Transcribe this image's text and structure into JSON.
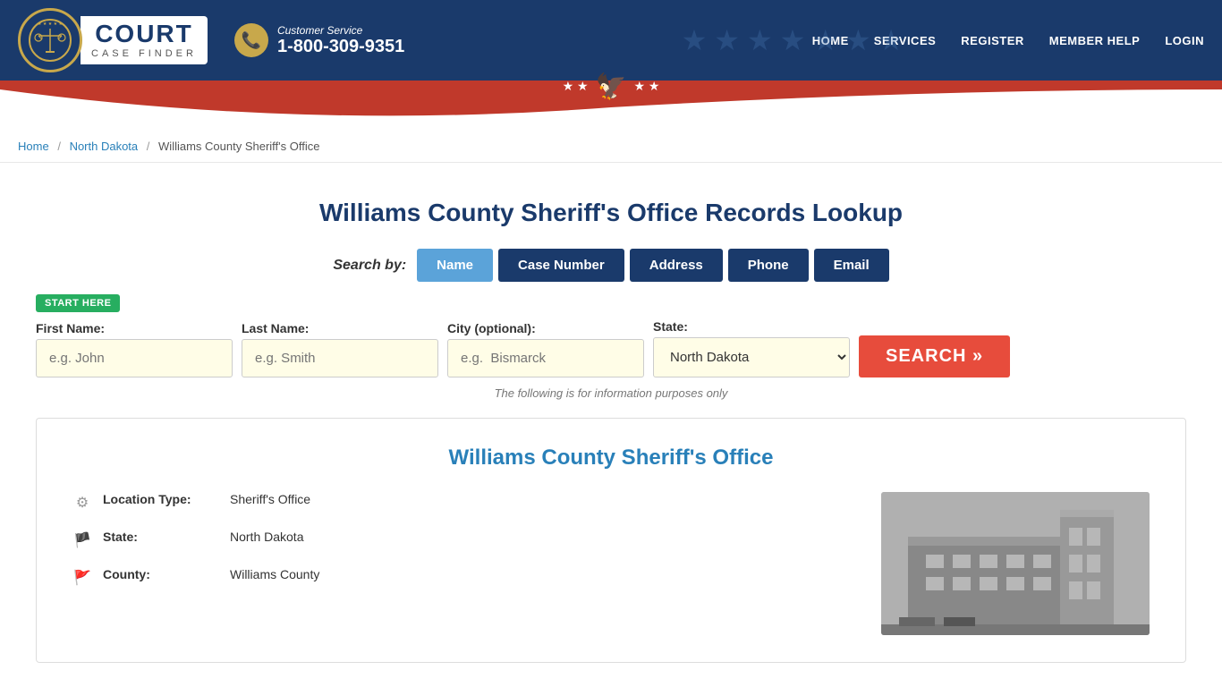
{
  "site": {
    "name": "Court Case Finder",
    "tagline": "CASE FINDER"
  },
  "header": {
    "customer_service_label": "Customer Service",
    "phone": "1-800-309-9351",
    "nav": [
      {
        "label": "HOME",
        "href": "#"
      },
      {
        "label": "SERVICES",
        "href": "#"
      },
      {
        "label": "REGISTER",
        "href": "#"
      },
      {
        "label": "MEMBER HELP",
        "href": "#"
      },
      {
        "label": "LOGIN",
        "href": "#"
      }
    ]
  },
  "breadcrumb": {
    "home": "Home",
    "state": "North Dakota",
    "current": "Williams County Sheriff's Office"
  },
  "page": {
    "title": "Williams County Sheriff's Office Records Lookup",
    "search_by_label": "Search by:"
  },
  "search_tabs": [
    {
      "label": "Name",
      "active": true
    },
    {
      "label": "Case Number",
      "active": false
    },
    {
      "label": "Address",
      "active": false
    },
    {
      "label": "Phone",
      "active": false
    },
    {
      "label": "Email",
      "active": false
    }
  ],
  "form": {
    "start_here": "START HERE",
    "first_name_label": "First Name:",
    "first_name_placeholder": "e.g. John",
    "last_name_label": "Last Name:",
    "last_name_placeholder": "e.g. Smith",
    "city_label": "City (optional):",
    "city_placeholder": "e.g.  Bismarck",
    "state_label": "State:",
    "state_value": "North Dakota",
    "search_button": "SEARCH »",
    "info_note": "The following is for information purposes only"
  },
  "info_card": {
    "title": "Williams County Sheriff's Office",
    "location_type_label": "Location Type:",
    "location_type_value": "Sheriff's Office",
    "state_label": "State:",
    "state_value": "North Dakota",
    "county_label": "County:",
    "county_value": "Williams County"
  }
}
